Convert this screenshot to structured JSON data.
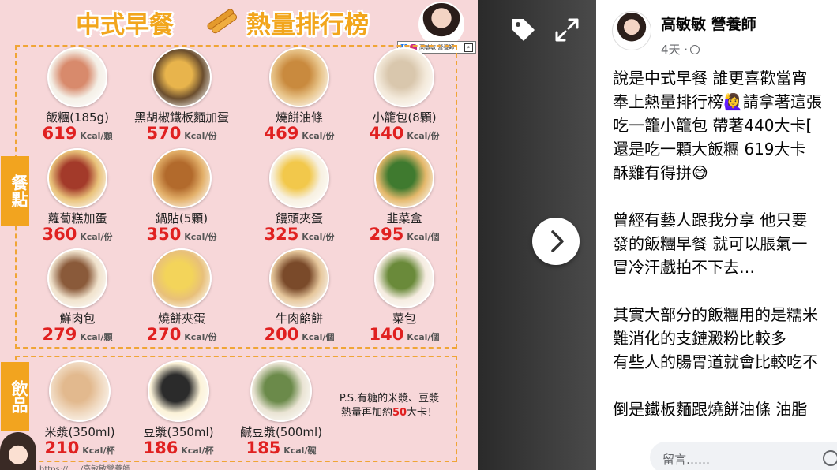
{
  "poster": {
    "title_left": "中式早餐",
    "title_right": "熱量排行榜",
    "brand_name": "高敏敏 營養師",
    "category_food": "餐點",
    "category_drink": "飲品",
    "ps_line1": "P.S.有糖的米漿、豆漿",
    "ps_line2_pre": "熱量再加約",
    "ps_line2_num": "50",
    "ps_line2_post": "大卡！",
    "url": "https://...../高敏敏營養師",
    "items": [
      {
        "name": "飯糰(185g)",
        "num": "619",
        "unit": "Kcal/顆",
        "photo": "rice-ball",
        "colors": [
          "#f4efe6",
          "#d88a6c"
        ]
      },
      {
        "name": "黑胡椒鐵板麵加蛋",
        "num": "570",
        "unit": "Kcal/份",
        "photo": "pepper-noodles",
        "colors": [
          "#6b4e2e",
          "#e8b44c"
        ]
      },
      {
        "name": "燒餅油條",
        "num": "469",
        "unit": "Kcal/份",
        "photo": "sesame-cake-cruller",
        "colors": [
          "#e8c48a",
          "#c98a3e"
        ]
      },
      {
        "name": "小籠包(8顆)",
        "num": "440",
        "unit": "Kcal/份",
        "photo": "soup-dumplings",
        "colors": [
          "#f3e9da",
          "#d9c7ad"
        ]
      },
      {
        "name": "蘿蔔糕加蛋",
        "num": "360",
        "unit": "Kcal/份",
        "photo": "radish-cake",
        "colors": [
          "#e9c27a",
          "#a33a2a"
        ]
      },
      {
        "name": "鍋貼(5顆)",
        "num": "350",
        "unit": "Kcal/份",
        "photo": "potstickers",
        "colors": [
          "#e3b06a",
          "#b26a2c"
        ]
      },
      {
        "name": "饅頭夾蛋",
        "num": "325",
        "unit": "Kcal/份",
        "photo": "mantou-egg",
        "colors": [
          "#f7f0e0",
          "#f2c84b"
        ]
      },
      {
        "name": "韭菜盒",
        "num": "295",
        "unit": "Kcal/個",
        "photo": "chive-box",
        "colors": [
          "#e4b86b",
          "#3f7a2f"
        ]
      },
      {
        "name": "鮮肉包",
        "num": "279",
        "unit": "Kcal/顆",
        "photo": "meat-bun",
        "colors": [
          "#f0e2cc",
          "#8a5a3a"
        ]
      },
      {
        "name": "燒餅夾蛋",
        "num": "270",
        "unit": "Kcal/份",
        "photo": "sesame-cake-egg",
        "colors": [
          "#e8c07a",
          "#f3d45a"
        ]
      },
      {
        "name": "牛肉餡餅",
        "num": "200",
        "unit": "Kcal/個",
        "photo": "beef-pie",
        "colors": [
          "#e6c79c",
          "#7a4a2a"
        ]
      },
      {
        "name": "菜包",
        "num": "140",
        "unit": "Kcal/個",
        "photo": "veg-bun",
        "colors": [
          "#f5ece0",
          "#6a8a3a"
        ]
      }
    ],
    "drinks": [
      {
        "name": "米漿(350ml)",
        "num": "210",
        "unit": "Kcal/杯",
        "photo": "rice-milk",
        "colors": [
          "#f0d9c0",
          "#e2b98e"
        ]
      },
      {
        "name": "豆漿(350ml)",
        "num": "186",
        "unit": "Kcal/杯",
        "photo": "soy-milk",
        "colors": [
          "#fbf2d8",
          "#2b2b2b"
        ]
      },
      {
        "name": "鹹豆漿(500ml)",
        "num": "185",
        "unit": "Kcal/碗",
        "photo": "savory-soy-milk",
        "colors": [
          "#eae4d4",
          "#6b8a4a"
        ]
      }
    ]
  },
  "nav": {
    "tag_icon": "tag-icon",
    "expand_icon": "expand-icon",
    "next_icon": "chevron-right-icon"
  },
  "post": {
    "author": "高敏敏 營養師",
    "time": "4天 ·",
    "lines": [
      "說是中式早餐 誰更喜歡當宵",
      "奉上熱量排行榜🙋‍♀️請拿著這張",
      "吃一籠小籠包 帶著440大卡[",
      "還是吃一顆大飯糰 619大卡",
      "酥雞有得拼😅",
      "",
      "曾經有藝人跟我分享 他只要",
      "發的飯糰早餐 就可以脹氣一",
      "冒冷汗戲拍不下去…",
      "",
      "其實大部分的飯糰用的是糯米",
      "難消化的支鏈澱粉比較多",
      "有些人的腸胃道就會比較吃不",
      "",
      "倒是鐵板麵跟燒餅油條 油脂"
    ],
    "comment_placeholder": "留言……"
  }
}
